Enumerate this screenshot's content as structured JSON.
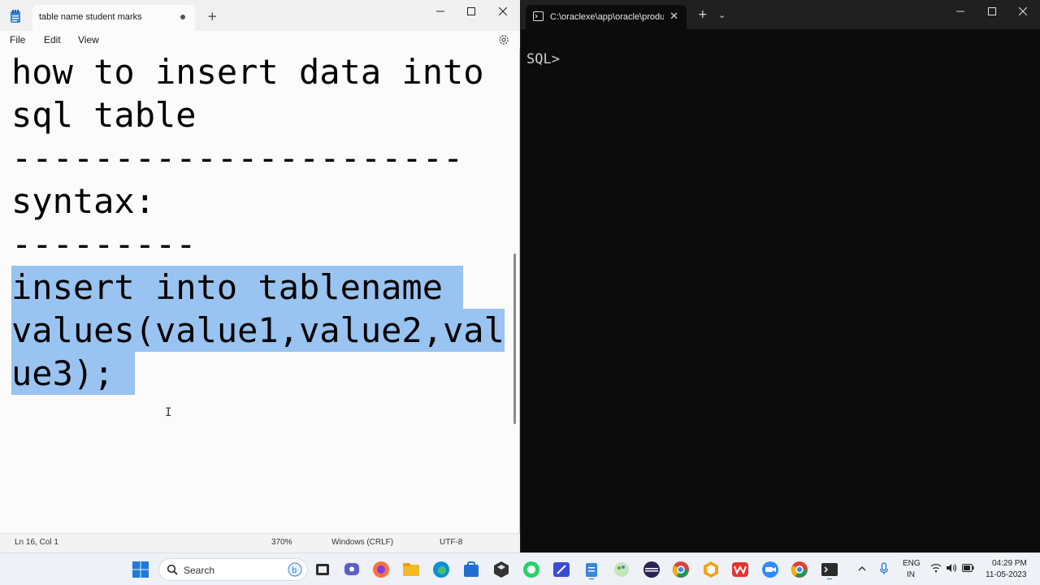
{
  "notepad": {
    "tab_title": "table name student marks",
    "menu": [
      "File",
      "Edit",
      "View"
    ],
    "lines": [
      "how to insert data into",
      "sql table",
      "----------------------",
      "syntax:",
      "---------",
      "insert into tablename ",
      "values(value1,value2,val",
      "ue3); "
    ],
    "status": {
      "position": "Ln 16, Col 1",
      "zoom": "370%",
      "line_ending": "Windows (CRLF)",
      "encoding": "UTF-8"
    }
  },
  "terminal": {
    "tab_title": "C:\\oraclexe\\app\\oracle\\produ",
    "prompt": "SQL>"
  },
  "taskbar": {
    "search_label": "Search",
    "language": "ENG",
    "region": "IN",
    "time": "04:29 PM",
    "date": "11-05-2023"
  },
  "colors": {
    "selection": "#99c3f0",
    "terminal_bg": "#0c0c0c",
    "notepad_bg": "#fbfbfb"
  }
}
